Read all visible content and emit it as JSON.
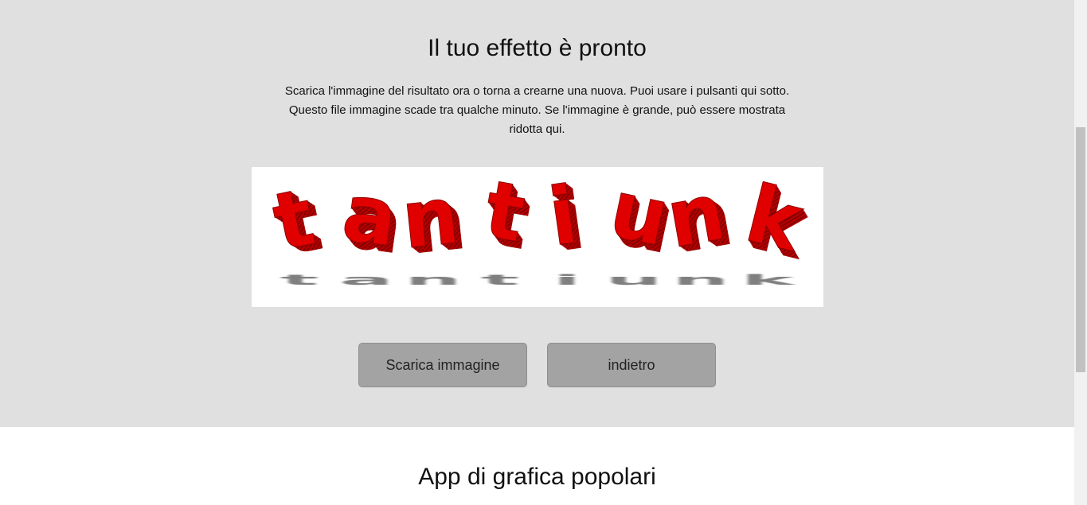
{
  "result": {
    "title": "Il tuo effetto è pronto",
    "description": "Scarica l'immagine del risultato ora o torna a crearne una nuova. Puoi usare i pulsanti qui sotto. Questo file immagine scade tra qualche minuto. Se l'immagine è grande, può essere mostrata ridotta qui.",
    "image_text": "tantiunk",
    "image_colors": {
      "fill": "#e00000",
      "side": "#8a0000",
      "shadow": "#555555"
    }
  },
  "buttons": {
    "download_label": "Scarica immagine",
    "back_label": "indietro"
  },
  "popular": {
    "title": "App di grafica popolari"
  }
}
